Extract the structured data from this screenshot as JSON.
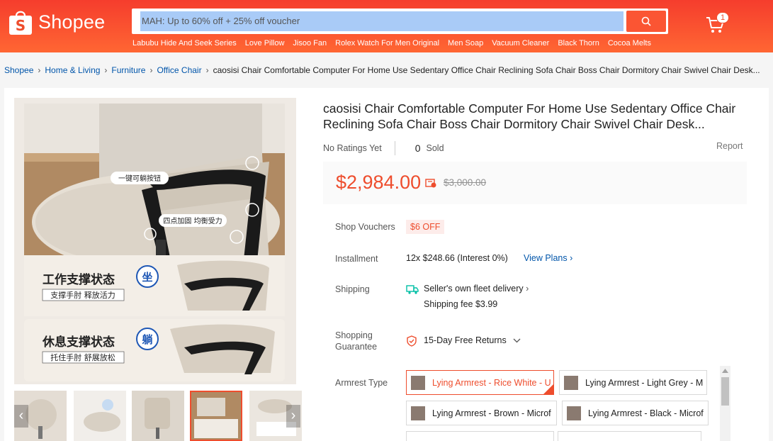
{
  "header": {
    "logo_text": "Shopee",
    "search_value": "MAH: Up to 60% off + 25% off voucher",
    "suggestions": [
      "Labubu Hide And Seek Series",
      "Love Pillow",
      "Jisoo Fan",
      "Rolex Watch For Men Original",
      "Men Soap",
      "Vacuum Cleaner",
      "Black Thorn",
      "Cocoa Melts"
    ],
    "cart_count": "1"
  },
  "breadcrumb": {
    "items": [
      "Shopee",
      "Home & Living",
      "Furniture",
      "Office Chair"
    ],
    "current": "caosisi Chair Comfortable Computer For Home Use Sedentary Office Chair Reclining Sofa Chair Boss Chair Dormitory Chair Swivel Chair Desk..."
  },
  "product": {
    "title": "caosisi Chair Comfortable Computer For Home Use Sedentary Office Chair Reclining Sofa Chair Boss Chair Dormitory Chair Swivel Chair Desk...",
    "ratings": "No Ratings Yet",
    "sold_count": "0",
    "sold_label": "Sold",
    "report": "Report",
    "price": "$2,984.00",
    "original_price": "$3,000.00",
    "image_text": {
      "button_tag": "一键可躺按钮",
      "reinforce_tag": "四点加固 均衡受力",
      "work_title": "工作支撑状态",
      "work_sub": "支撑手肘 释放活力",
      "work_badge": "坐",
      "rest_title": "休息支撑状态",
      "rest_sub": "托住手肘 舒展放松",
      "rest_badge": "躺"
    }
  },
  "details": {
    "vouchers_label": "Shop Vouchers",
    "voucher": "$6 OFF",
    "installment_label": "Installment",
    "installment_value": "12x $248.66 (Interest 0%)",
    "view_plans": "View Plans",
    "shipping_label": "Shipping",
    "shipping_method": "Seller's own fleet delivery",
    "shipping_fee": "Shipping fee $3.99",
    "guarantee_label_1": "Shopping",
    "guarantee_label_2": "Guarantee",
    "guarantee_value": "15-Day Free Returns",
    "armrest_label": "Armrest Type",
    "armrest_options": [
      "Lying Armrest - Rice White - U",
      "Lying Armrest - Light Grey - M",
      "Lying Armrest - Brown - Microf",
      "Lying Armrest - Black - Microf"
    ]
  },
  "colors": {
    "brand": "#ee4d2d",
    "link": "#0055aa"
  }
}
